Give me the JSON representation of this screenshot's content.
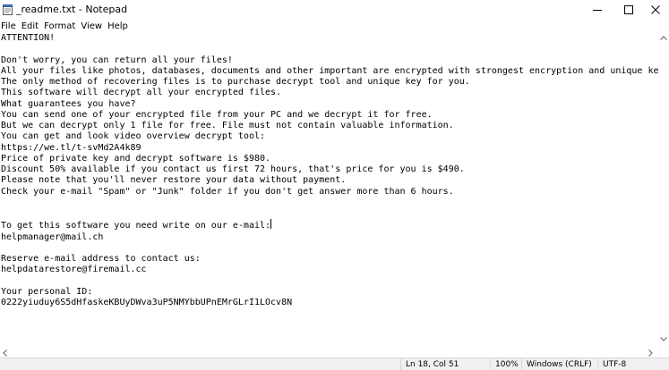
{
  "window": {
    "title": "_readme.txt - Notepad",
    "icon": "notepad-icon"
  },
  "menu": {
    "items": [
      "File",
      "Edit",
      "Format",
      "View",
      "Help"
    ]
  },
  "editor": {
    "text_before_caret": "ATTENTION!\n\nDon't worry, you can return all your files!\nAll your files like photos, databases, documents and other important are encrypted with strongest encryption and unique key.\nThe only method of recovering files is to purchase decrypt tool and unique key for you.\nThis software will decrypt all your encrypted files.\nWhat guarantees you have?\nYou can send one of your encrypted file from your PC and we decrypt it for free.\nBut we can decrypt only 1 file for free. File must not contain valuable information.\nYou can get and look video overview decrypt tool:\nhttps://we.tl/t-svMd2A4k89\nPrice of private key and decrypt software is $980.\nDiscount 50% available if you contact us first 72 hours, that's price for you is $490.\nPlease note that you'll never restore your data without payment.\nCheck your e-mail \"Spam\" or \"Junk\" folder if you don't get answer more than 6 hours.\n\n\nTo get this software you need write on our e-mail:",
    "text_after_caret": "\nhelpmanager@mail.ch\n\nReserve e-mail address to contact us:\nhelpdatarestore@firemail.cc\n\nYour personal ID:\n0222yiuduy6S5dHfaskeKBUyDWva3uP5NMYbbUPnEMrGLrI1LOcv8N"
  },
  "statusbar": {
    "position": "Ln 18, Col 51",
    "zoom": "100%",
    "line_ending": "Windows (CRLF)",
    "encoding": "UTF-8"
  },
  "colors": {
    "background": "#ffffff",
    "statusbar": "#f0f0f0",
    "text": "#000000"
  }
}
